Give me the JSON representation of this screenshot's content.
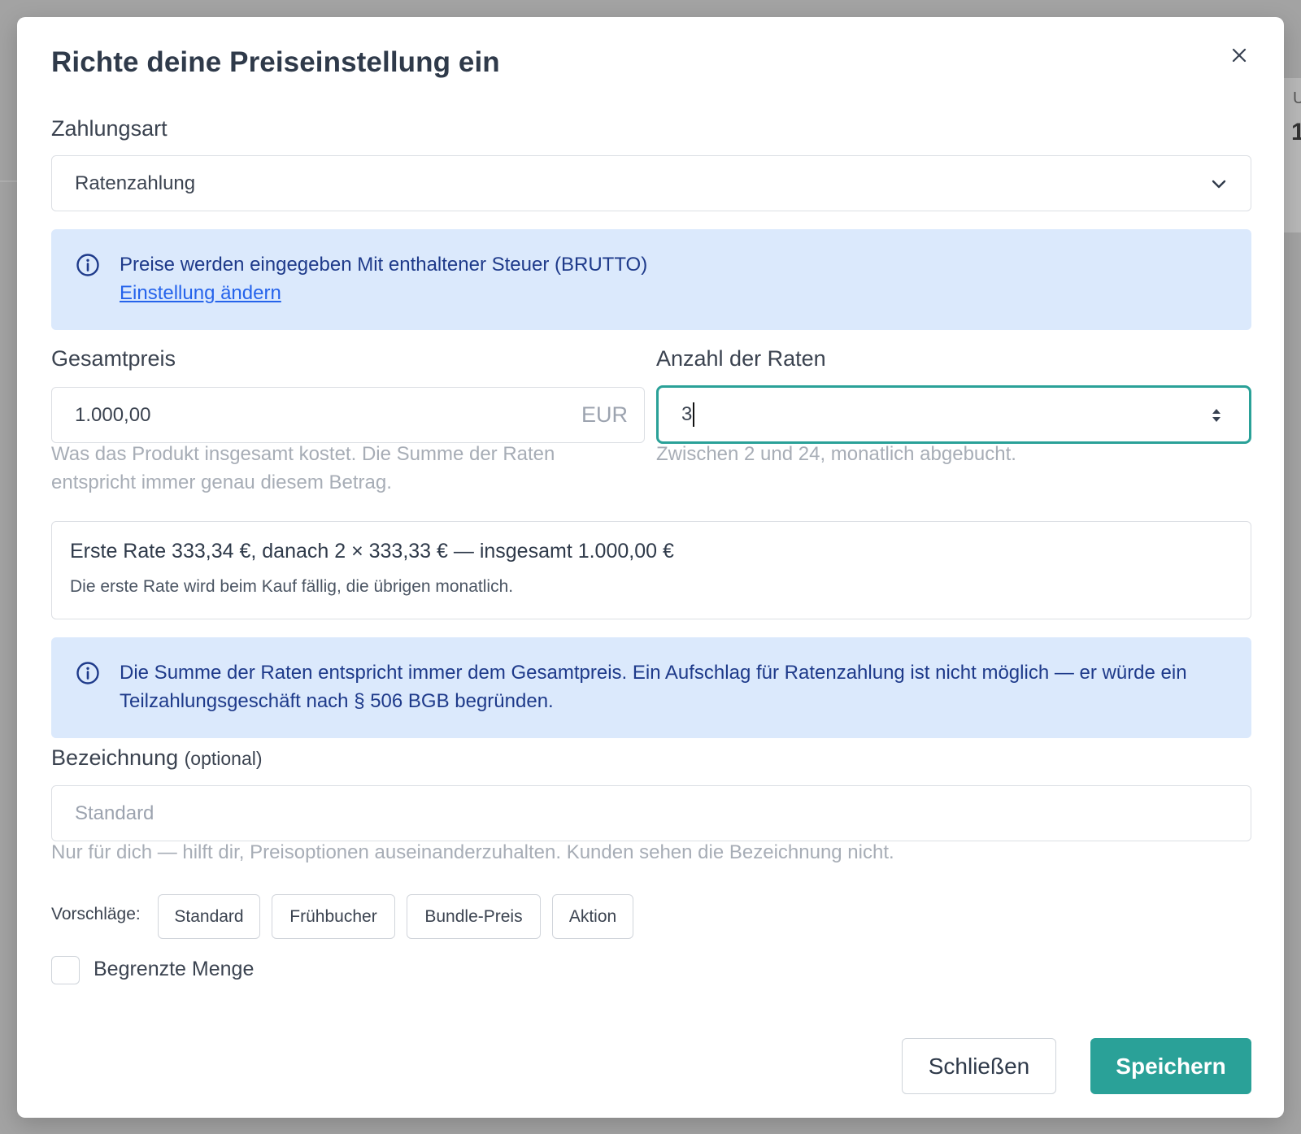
{
  "background": {
    "text_a": "U",
    "text_b": "1"
  },
  "modal": {
    "title": "Richte deine Preiseinstellung ein",
    "close_icon": "close-icon"
  },
  "payment_type": {
    "label": "Zahlungsart",
    "selected": "Ratenzahlung"
  },
  "tax_alert": {
    "text": "Preise werden eingegeben Mit enthaltener Steuer (BRUTTO)",
    "link": "Einstellung ändern"
  },
  "total_price": {
    "label": "Gesamtpreis",
    "value": "1.000,00",
    "currency": "EUR",
    "hint": "Was das Produkt insgesamt kostet. Die Summe der Raten entspricht immer genau diesem Betrag."
  },
  "installments": {
    "label": "Anzahl der Raten",
    "value": "3",
    "hint": "Zwischen 2 und 24, monatlich abgebucht."
  },
  "summary": {
    "main": "Erste Rate 333,34 €, danach 2 × 333,33 € — insgesamt 1.000,00 €",
    "sub": "Die erste Rate wird beim Kauf fällig, die übrigen monatlich."
  },
  "bgb_alert": {
    "text": "Die Summe der Raten entspricht immer dem Gesamtpreis. Ein Aufschlag für Ratenzahlung ist nicht möglich — er würde ein Teilzahlungsgeschäft nach § 506 BGB begründen."
  },
  "designation": {
    "label": "Bezeichnung",
    "optional": "(optional)",
    "placeholder": "Standard",
    "hint": "Nur für dich — hilft dir, Preisoptionen auseinanderzuhalten. Kunden sehen die Bezeichnung nicht."
  },
  "suggestions": {
    "label": "Vorschläge:",
    "items": [
      "Standard",
      "Frühbucher",
      "Bundle-Preis",
      "Aktion"
    ]
  },
  "limited": {
    "label": "Begrenzte Menge",
    "checked": false
  },
  "footer": {
    "close": "Schließen",
    "save": "Speichern"
  },
  "colors": {
    "accent": "#2aa198",
    "alert_bg": "#dbe9fc",
    "alert_text": "#1e3a8a",
    "link": "#2563eb"
  }
}
